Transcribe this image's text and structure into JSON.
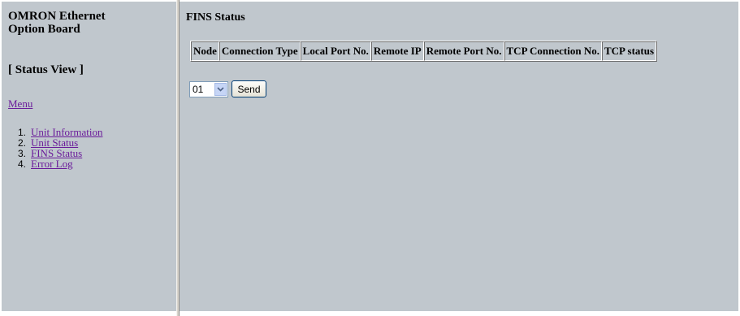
{
  "sidebar": {
    "brand_line1": "OMRON Ethernet",
    "brand_line2": "Option Board",
    "view_title": "[ Status View ]",
    "menu_label": "Menu",
    "items": [
      {
        "number": "1.",
        "label": "Unit Information"
      },
      {
        "number": "2.",
        "label": "Unit Status"
      },
      {
        "number": "3.",
        "label": "FINS Status"
      },
      {
        "number": "4.",
        "label": "Error Log"
      }
    ]
  },
  "main": {
    "title": "FINS Status",
    "table": {
      "columns": [
        "Node",
        "Connection Type",
        "Local Port No.",
        "Remote IP",
        "Remote Port No.",
        "TCP Connection No.",
        "TCP status"
      ]
    },
    "node_select": {
      "value": "01"
    },
    "send_label": "Send"
  },
  "colors": {
    "background": "#c0c7cd",
    "link": "#6a1b9a"
  }
}
